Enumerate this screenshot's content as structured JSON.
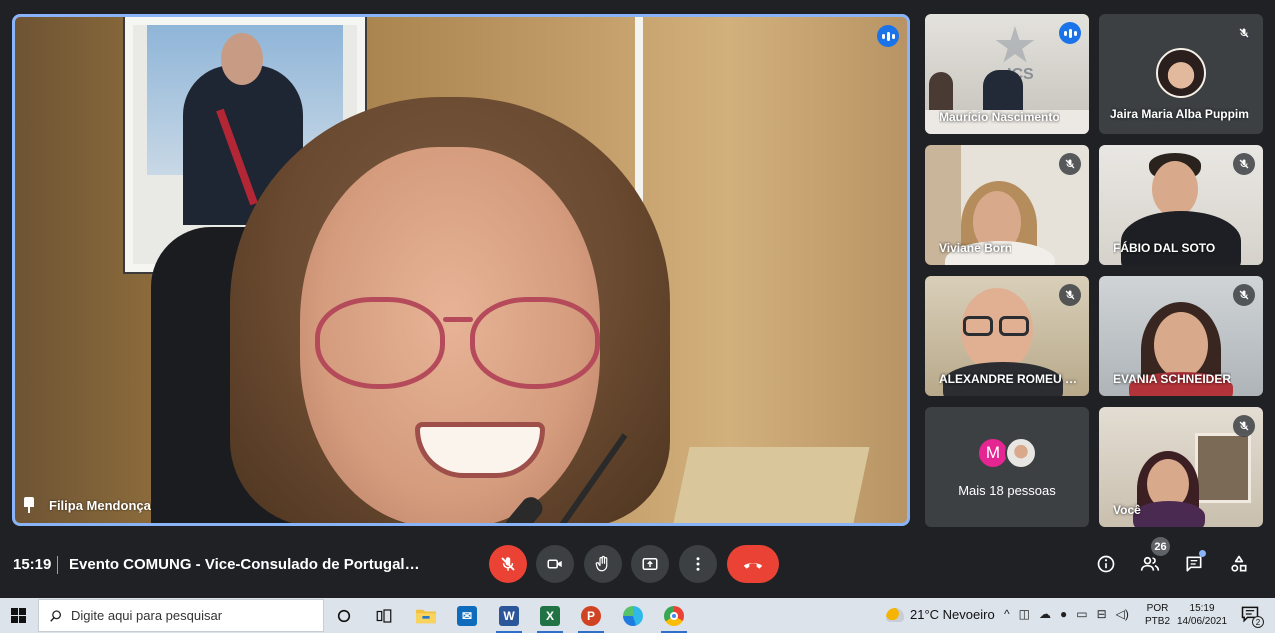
{
  "main_participant": {
    "name": "Filipa Mendonça",
    "pinned": true,
    "speaking": true
  },
  "tiles": [
    {
      "name": "Maurício Nascimento",
      "status": "speaking"
    },
    {
      "name": "Jaira Maria Alba Puppim",
      "status": "muted"
    },
    {
      "name": "Viviane Born",
      "status": "muted"
    },
    {
      "name": "FÁBIO DAL SOTO",
      "status": "muted"
    },
    {
      "name": "ALEXANDRE ROMEU LUIZ",
      "status": "muted"
    },
    {
      "name": "EVANIA SCHNEIDER",
      "status": "muted"
    },
    {
      "name": "Você",
      "status": "muted"
    }
  ],
  "overflow_tile": {
    "avatar_letter": "M",
    "label": "Mais 18 pessoas"
  },
  "bottom_bar": {
    "time": "15:19",
    "meeting_title": "Evento COMUNG - Vice-Consulado de Portugal em Porto Alegre",
    "participant_count": "26"
  },
  "colors": {
    "accent": "#8ab4f8",
    "speaking": "#1a73e8",
    "danger": "#ea4335",
    "background": "#202124",
    "tile": "#3c4043"
  },
  "taskbar": {
    "search_placeholder": "Digite aqui para pesquisar",
    "weather": "21°C Nevoeiro",
    "language_line1": "POR",
    "language_line2": "PTB2",
    "clock_time": "15:19",
    "clock_date": "14/06/2021",
    "notification_count": "2",
    "apps": [
      "task-view-icon",
      "file-explorer-icon",
      "mail-icon",
      "word-icon",
      "excel-icon",
      "powerpoint-icon",
      "edge-icon",
      "chrome-icon"
    ]
  }
}
